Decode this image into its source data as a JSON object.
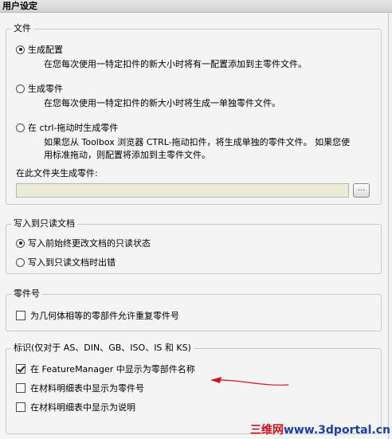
{
  "header": {
    "title": "用户设定"
  },
  "file_group": {
    "title": "文件",
    "option1": {
      "label": "生成配置",
      "desc": "在您每次使用一特定扣件的新大小时将有一配置添加到主零件文件。"
    },
    "option2": {
      "label": "生成零件",
      "desc": "在您每次使用一特定扣件的新大小时将生成一单独零件文件。"
    },
    "option3": {
      "label": "在 ctrl-拖动时生成零件",
      "desc_line1": "如果您从 Toolbox 浏览器 CTRL-拖动扣件，将生成单独的零件文件。 如果您使",
      "desc_line2": "用标准拖动，则配置将添加到主零件文件。"
    },
    "folder_label": "在此文件夹生成零件:",
    "folder_value": "",
    "browse_label": "..."
  },
  "readonly_group": {
    "title": "写入到只读文档",
    "option1": "写入前始终更改文档的只读状态",
    "option2": "写入到只读文档时出错"
  },
  "part_number_group": {
    "title": "零件号",
    "check1": "为几何体相等的零部件允许重复零件号"
  },
  "id_group": {
    "title": "标识(仅对于 AS、DIN、GB、ISO、IS 和 KS)",
    "check1": "在 FeatureManager 中显示为零部件名称",
    "check2": "在材料明细表中显示为零件号",
    "check3": "在材料明细表中显示为说明"
  },
  "state": {
    "file_option": "option1",
    "readonly_option": "option1",
    "allow_duplicate": false,
    "show_featuremanager": true,
    "show_bom_part_number": false,
    "show_bom_description": false
  },
  "colors": {
    "arrow": "#d0141e",
    "watermark_red": "#c8141e",
    "watermark_blue": "#1a3fa8"
  },
  "watermark": {
    "part1": "三维网",
    "part2": "www.3dportal.cn"
  }
}
